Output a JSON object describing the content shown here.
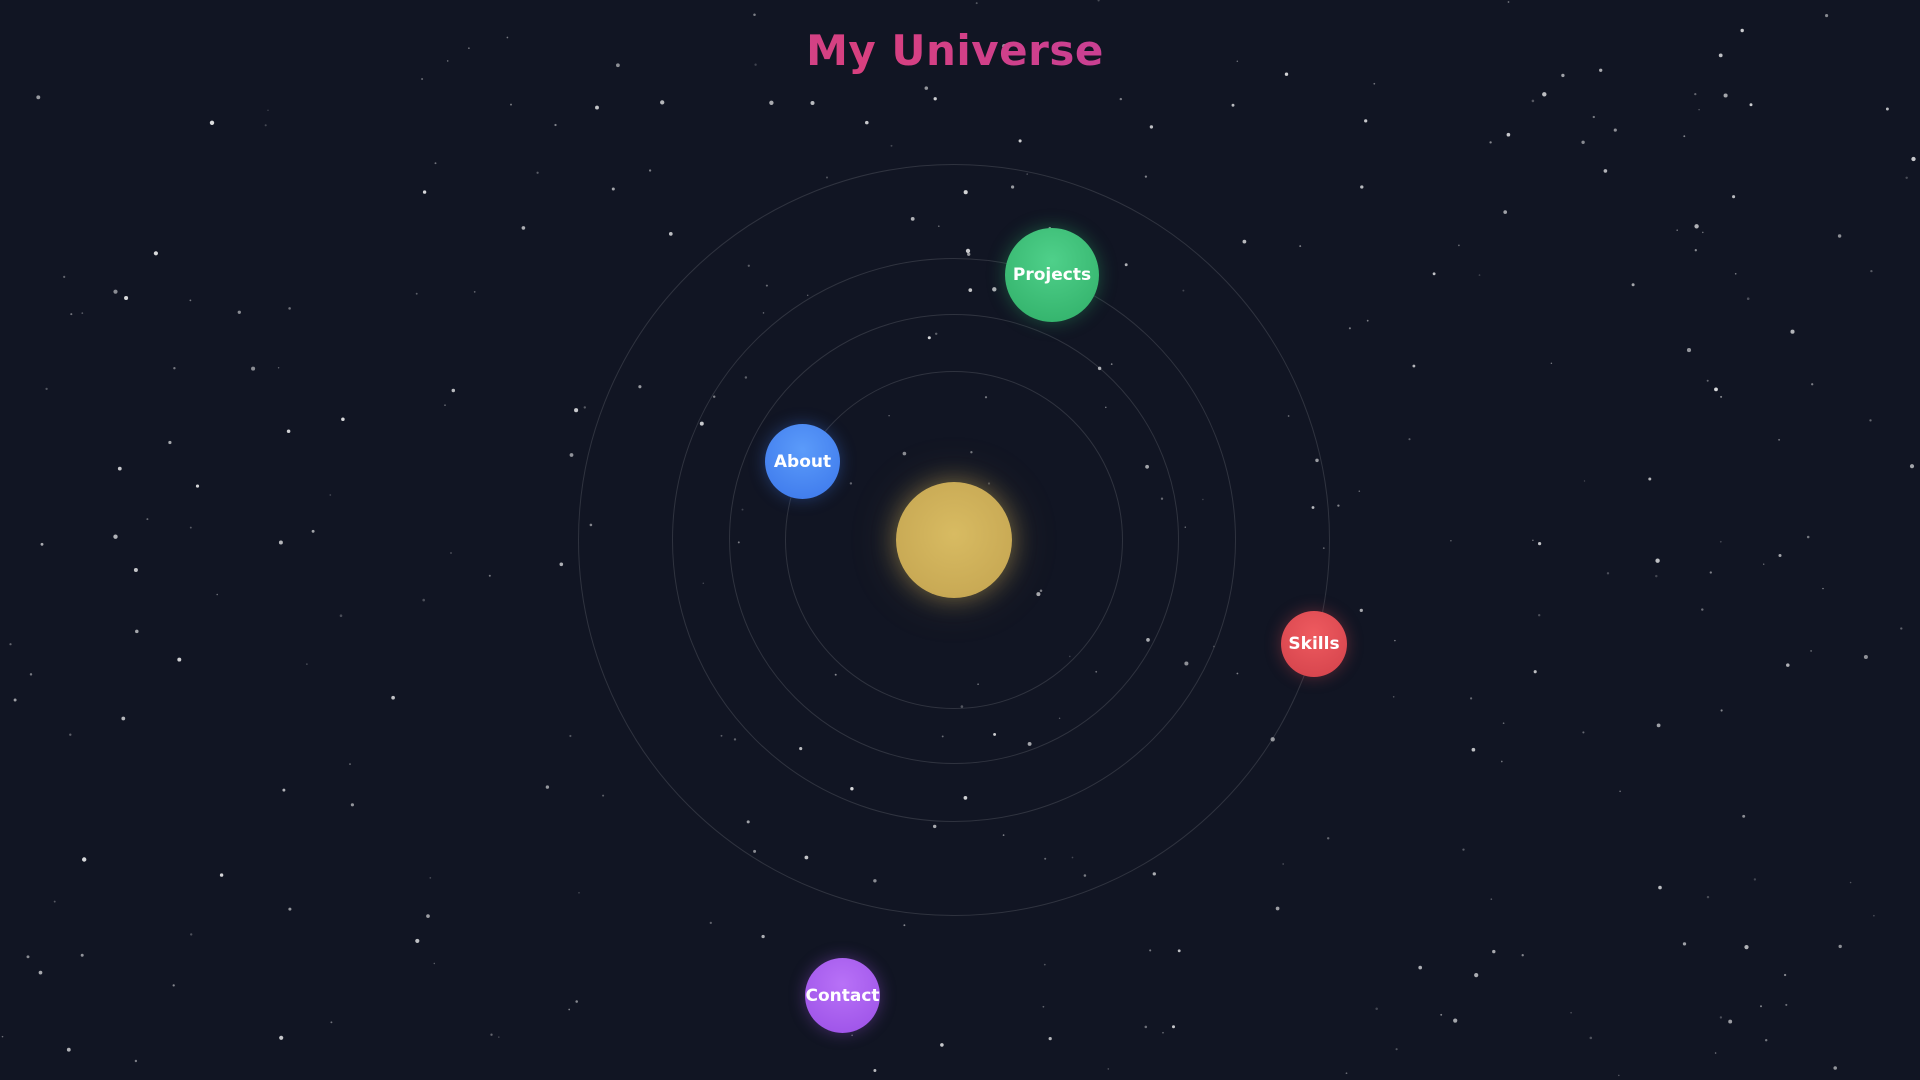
{
  "page": {
    "title": "My Universe"
  },
  "planets": {
    "projects": {
      "label": "Projects",
      "color": "#34c274"
    },
    "about": {
      "label": "About",
      "color": "#4a86f2"
    },
    "skills": {
      "label": "Skills",
      "color": "#e04c55"
    },
    "contact": {
      "label": "Contact",
      "color": "#a85cf0"
    }
  },
  "sun": {
    "color": "#d2b45c"
  },
  "background": {
    "color": "#111523",
    "star_color": "#ffffff"
  }
}
